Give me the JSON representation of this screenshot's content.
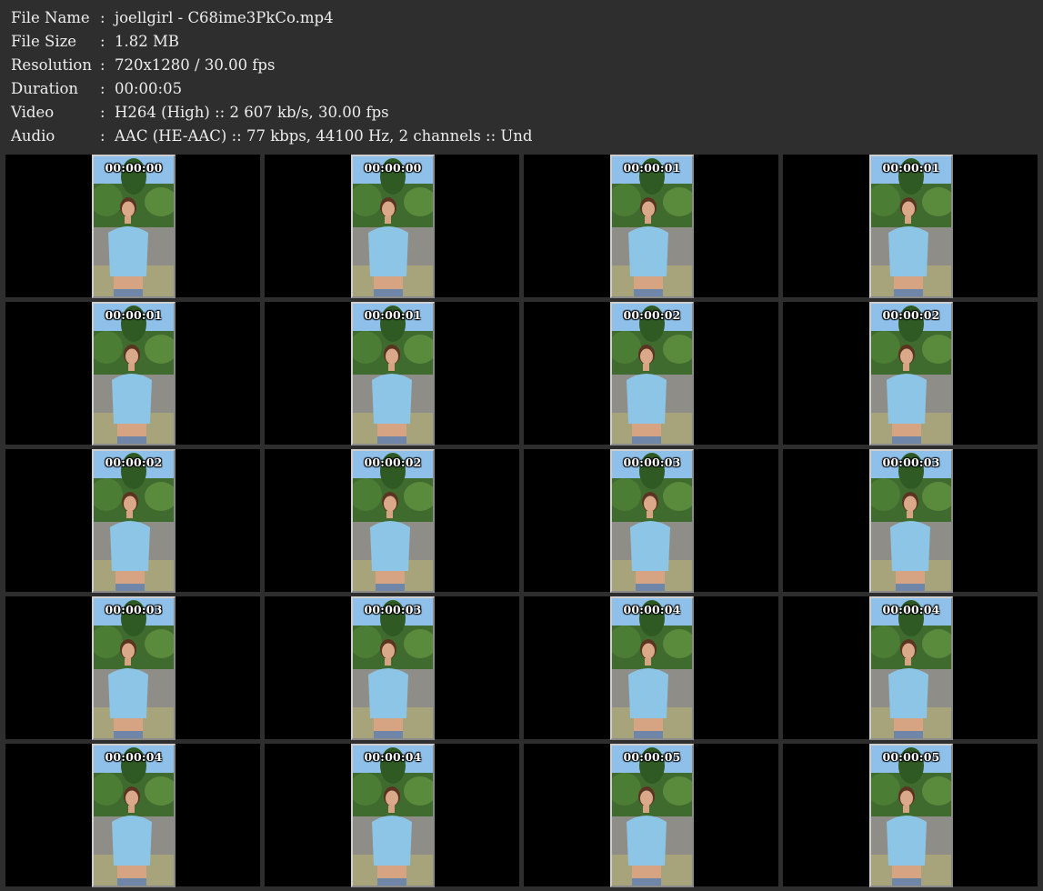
{
  "info": [
    {
      "label": "File Name",
      "sep": ":",
      "value": "joellgirl - C68ime3PkCo.mp4"
    },
    {
      "label": "File Size",
      "sep": ":",
      "value": "1.82 MB"
    },
    {
      "label": "Resolution",
      "sep": ":",
      "value": "720x1280 / 30.00 fps"
    },
    {
      "label": "Duration",
      "sep": ":",
      "value": "00:00:05"
    },
    {
      "label": "Video",
      "sep": ":",
      "value": "H264 (High) :: 2 607 kb/s, 30.00 fps"
    },
    {
      "label": "Audio",
      "sep": ":",
      "value": "AAC (HE-AAC) :: 77 kbps, 44100 Hz, 2 channels :: Und"
    }
  ],
  "thumbnails": [
    {
      "time": "00:00:00"
    },
    {
      "time": "00:00:00"
    },
    {
      "time": "00:00:01"
    },
    {
      "time": "00:00:01"
    },
    {
      "time": "00:00:01"
    },
    {
      "time": "00:00:01"
    },
    {
      "time": "00:00:02"
    },
    {
      "time": "00:00:02"
    },
    {
      "time": "00:00:02"
    },
    {
      "time": "00:00:02"
    },
    {
      "time": "00:00:03"
    },
    {
      "time": "00:00:03"
    },
    {
      "time": "00:00:03"
    },
    {
      "time": "00:00:03"
    },
    {
      "time": "00:00:04"
    },
    {
      "time": "00:00:04"
    },
    {
      "time": "00:00:04"
    },
    {
      "time": "00:00:04"
    },
    {
      "time": "00:00:05"
    },
    {
      "time": "00:00:05"
    }
  ],
  "colors": {
    "background": "#2e2e2e",
    "cell": "#000000",
    "text": "#ededed"
  }
}
